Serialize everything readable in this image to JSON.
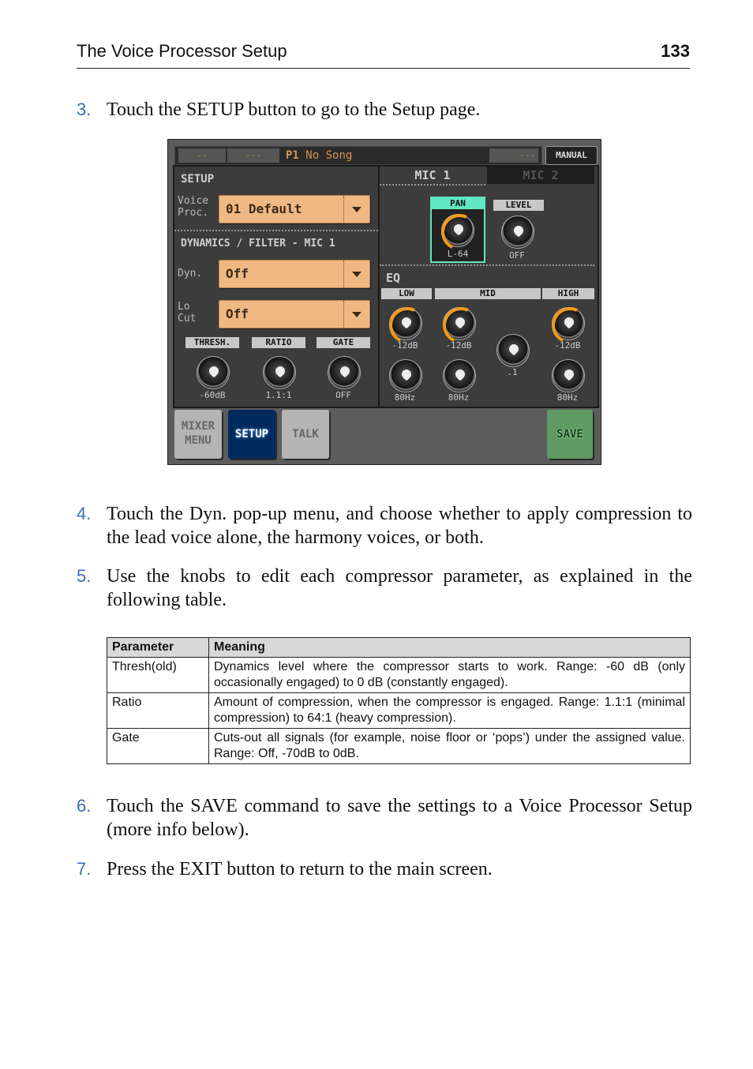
{
  "header": {
    "title": "The Voice Processor Setup",
    "page_number": "133"
  },
  "steps": [
    {
      "number": "3.",
      "text": "Touch the SETUP button to go to the Setup page."
    },
    {
      "number": "4.",
      "text": "Touch the Dyn. pop-up menu, and choose whether to apply compression to the lead voice alone, the harmony voices, or both."
    },
    {
      "number": "5.",
      "text": "Use the knobs to edit each compressor parameter, as explained in the following table."
    },
    {
      "number": "6.",
      "text": "Touch the SAVE command to save the settings to a Voice Processor Setup (more info below)."
    },
    {
      "number": "7.",
      "text": "Press the EXIT button to return to the main screen."
    }
  ],
  "screen": {
    "topbar": {
      "seg1": "--",
      "seg2": "---",
      "song_prefix": "P1",
      "song_name": "No Song",
      "seg3": "---",
      "manual_label": "MANUAL"
    },
    "setup": {
      "title": "SETUP",
      "voice_proc_label": "Voice Proc.",
      "voice_proc_value": "01 Default",
      "dyn_section_title": "DYNAMICS / FILTER - MIC 1",
      "dyn_label": "Dyn.",
      "dyn_value": "Off",
      "locut_label": "Lo Cut",
      "locut_value": "Off",
      "knobs": [
        {
          "label": "THRESH.",
          "value": "-60dB"
        },
        {
          "label": "RATIO",
          "value": "1.1:1"
        },
        {
          "label": "GATE",
          "value": "OFF"
        }
      ]
    },
    "mic_tabs": [
      {
        "label": "MIC 1",
        "active": true
      },
      {
        "label": "MIC 2",
        "active": false
      }
    ],
    "pan": {
      "label": "PAN",
      "value": "L-64"
    },
    "level": {
      "label": "LEVEL",
      "value": "OFF"
    },
    "eq": {
      "title": "EQ",
      "bands": [
        "LOW",
        "MID",
        "HIGH"
      ],
      "low_gain": "-12dB",
      "low_freq": "80Hz",
      "mid_gain": "-12dB",
      "mid_freq": "80Hz",
      "mid_q": ".1",
      "high_gain": "-12dB",
      "high_freq": "80Hz"
    },
    "buttons": {
      "mixer_menu": "MIXER MENU",
      "setup": "SETUP",
      "talk": "TALK",
      "save": "SAVE"
    }
  },
  "table": {
    "headers": [
      "Parameter",
      "Meaning"
    ],
    "rows": [
      [
        "Thresh(old)",
        "Dynamics level where the compressor starts to work. Range: -60 dB (only occasionally engaged) to 0 dB (constantly engaged)."
      ],
      [
        "Ratio",
        "Amount of compression, when the compressor is engaged. Range: 1.1:1 (minimal compression) to 64:1 (heavy compression)."
      ],
      [
        "Gate",
        "Cuts-out all signals (for example, noise floor or ‘pops’) under the assigned value. Range: Off, -70dB to 0dB."
      ]
    ]
  }
}
